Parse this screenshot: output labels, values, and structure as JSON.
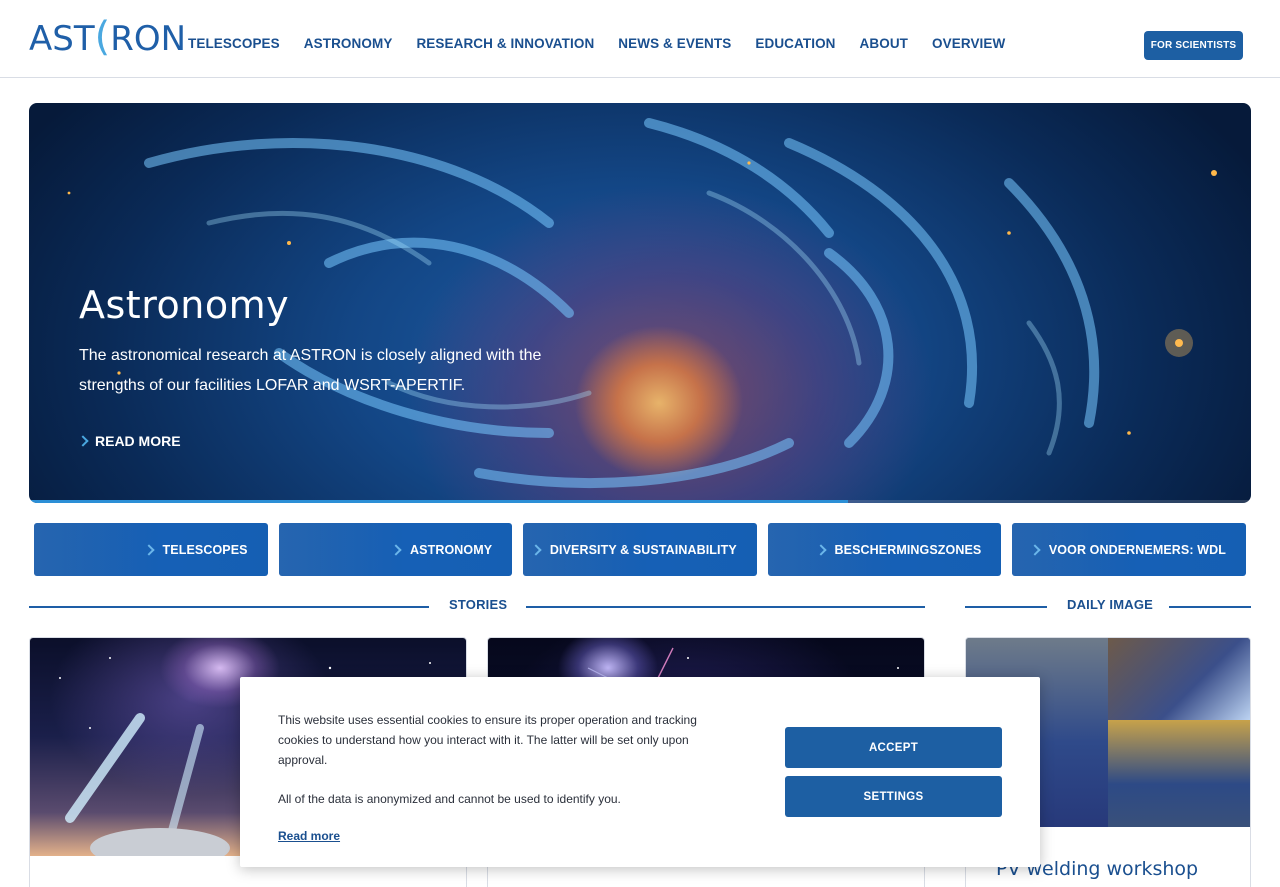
{
  "header": {
    "logo_text": "ASTRON",
    "nav": [
      "TELESCOPES",
      "ASTRONOMY",
      "RESEARCH & INNOVATION",
      "NEWS & EVENTS",
      "EDUCATION",
      "ABOUT",
      "OVERVIEW"
    ],
    "scientists_button": "FOR SCIENTISTS"
  },
  "hero": {
    "title": "Astronomy",
    "description": "The astronomical research at ASTRON is closely aligned with the strengths of our facilities LOFAR and WSRT-APERTIF.",
    "read_more": "READ MORE",
    "slide_progress": 0.67
  },
  "quick_links": [
    "TELESCOPES",
    "ASTRONOMY",
    "DIVERSITY & SUSTAINABILITY",
    "BESCHERMINGSZONES",
    "VOOR ONDERNEMERS: WDL"
  ],
  "sections": {
    "stories": "STORIES",
    "daily_image": "DAILY IMAGE"
  },
  "daily_image": {
    "title": "PV welding workshop"
  },
  "cookie": {
    "text1": "This website uses essential cookies to ensure its proper operation and tracking cookies to understand how you interact with it. The latter will be set only upon approval.",
    "text2": "All of the data is anonymized and cannot be used to identify you.",
    "read_more": "Read more",
    "accept": "ACCEPT",
    "settings": "SETTINGS"
  },
  "colors": {
    "brand_blue": "#1d5fa3",
    "accent_light_blue": "#4aa8e0",
    "nav_text": "#1a4f8f"
  }
}
